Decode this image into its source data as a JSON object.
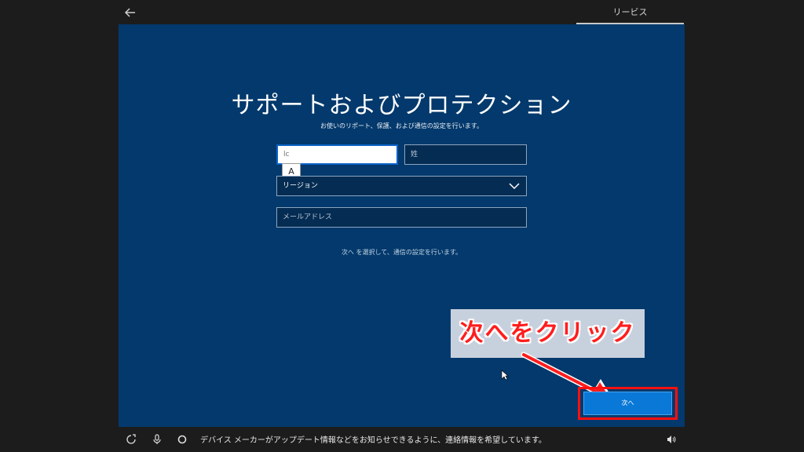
{
  "header": {
    "tab_label": "リービス"
  },
  "page": {
    "title": "サポートおよびプロテクション",
    "subtitle": "お使いのリポート、保護、および通信の設定を行います。"
  },
  "form": {
    "first_name_value": "lc",
    "last_name_placeholder": "姓",
    "ime_indicator": "A",
    "region_label": "リージョン",
    "email_placeholder": "メールアドレス"
  },
  "hint": "次へ を選択して、通信の設定を行います。",
  "callout": {
    "text": "次へをクリック",
    "text_color": "#ff1d1d"
  },
  "next_button": {
    "label": "次へ"
  },
  "status_bar": {
    "message": "デバイス メーカーがアップデート情報などをお知らせできるように、連絡情報を希望しています。"
  },
  "colors": {
    "panel_bg": "#03396c",
    "accent": "#0a78d7",
    "highlight": "#ff1010"
  }
}
